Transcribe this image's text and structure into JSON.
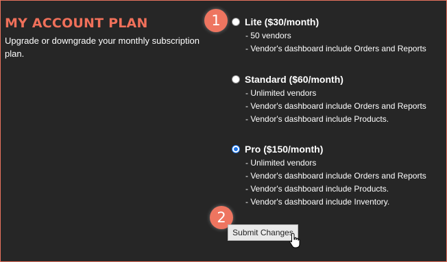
{
  "header": {
    "title": "MY ACCOUNT PLAN",
    "description": "Upgrade or downgrade your monthly subscription plan."
  },
  "plans": [
    {
      "name": "Lite ($30/month)",
      "selected": false,
      "features": [
        "- 50 vendors",
        "- Vendor's dashboard include Orders and Reports"
      ]
    },
    {
      "name": "Standard ($60/month)",
      "selected": false,
      "features": [
        "- Unlimited vendors",
        "- Vendor's dashboard include Orders and Reports",
        "- Vendor's dashboard include Products."
      ]
    },
    {
      "name": "Pro ($150/month)",
      "selected": true,
      "features": [
        "- Unlimited vendors",
        "- Vendor's dashboard include Orders and Reports",
        "- Vendor's dashboard include Products.",
        "- Vendor's dashboard include Inventory."
      ]
    }
  ],
  "submit_label": "Submit Changes",
  "callouts": [
    "1",
    "2"
  ],
  "colors": {
    "accent": "#f0705a",
    "badge": "#ee7560",
    "background": "#262626",
    "radio_selected": "#1a73e8"
  }
}
